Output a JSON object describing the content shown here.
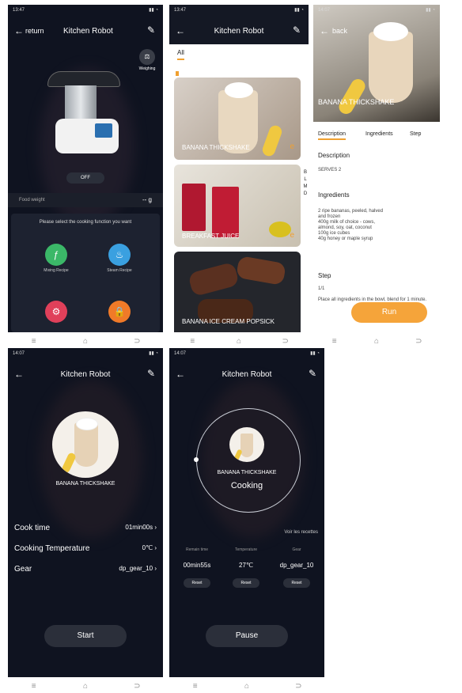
{
  "status_times": [
    "13:47",
    "13:47",
    "14:07",
    "14:07",
    "14:07"
  ],
  "screen1": {
    "back": "return",
    "title": "Kitchen Robot",
    "weighing": "Weighing",
    "off": "OFF",
    "food_weight": "Food weight",
    "food_weight_value": "-- g",
    "prompt": "Please select the cooking function you want",
    "functions": [
      {
        "label": "Mixing Recipe",
        "color": "#3bb868",
        "icon": "mixing-icon"
      },
      {
        "label": "Steam Recipe",
        "color": "#3aa0e0",
        "icon": "steam-icon"
      },
      {
        "label": "",
        "color": "#e0405a",
        "icon": "gear-icon"
      },
      {
        "label": "",
        "color": "#f07a28",
        "icon": "lock-icon"
      }
    ]
  },
  "screen2": {
    "title": "Kitchen Robot",
    "tab": "All",
    "alpha": [
      "B",
      "L",
      "M",
      "D"
    ],
    "recipes": [
      "BANANA THICKSHAKE",
      "BREAKFAST JUICE",
      "BANANA ICE CREAM POPSICK"
    ]
  },
  "screen3": {
    "back": "back",
    "hero_title": "BANANA THICKSHAKE",
    "tabs": [
      "Description",
      "Ingredients",
      "Step"
    ],
    "desc_heading": "Description",
    "desc_text": "SERVES 2",
    "ing_heading": "Ingredients",
    "ingredients": [
      "2 ripe bananas, peeled, halved",
      "and frozen",
      "400g milk of choice - cows,",
      "almond, soy, oat, coconut",
      "100g ice cubes",
      "40g honey or maple syrup"
    ],
    "step_heading": "Step",
    "step_num": "1/1",
    "step_text": "Place all ingredients in the bowl, blend for 1 minute.",
    "run": "Run"
  },
  "screen4": {
    "title": "Kitchen Robot",
    "recipe": "BANANA THICKSHAKE",
    "rows": [
      {
        "label": "Cook time",
        "value": "01min00s"
      },
      {
        "label": "Cooking Temperature",
        "value": "0℃"
      },
      {
        "label": "Gear",
        "value": "dp_gear_10"
      }
    ],
    "start": "Start"
  },
  "screen5": {
    "title": "Kitchen Robot",
    "recipe": "BANANA THICKSHAKE",
    "status": "Cooking",
    "more": "Voir les recettes",
    "cols": [
      {
        "label": "Remain time",
        "value": "00min55s",
        "reset": "Reset"
      },
      {
        "label": "Temperature",
        "value": "27℃",
        "reset": "Reset"
      },
      {
        "label": "Gear",
        "value": "dp_gear_10",
        "reset": "Reset"
      }
    ],
    "pause": "Pause"
  },
  "colors": {
    "accent": "#f0a030",
    "bg": "#0f1320"
  }
}
